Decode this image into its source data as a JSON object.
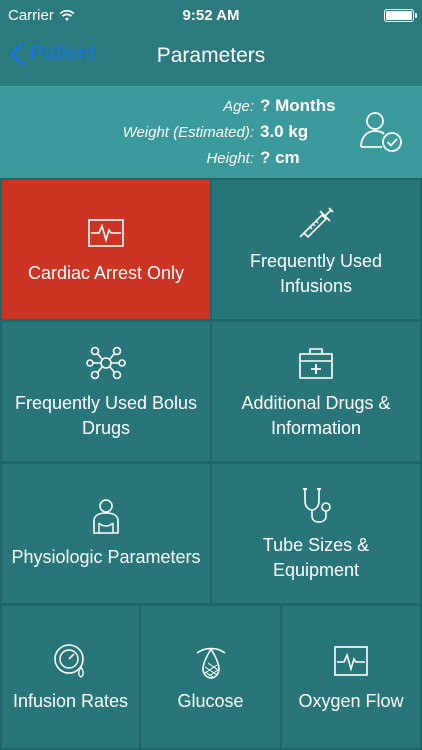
{
  "status": {
    "carrier": "Carrier",
    "time": "9:52 AM"
  },
  "nav": {
    "back_label": "Patient",
    "title": "Parameters"
  },
  "patient": {
    "age_label": "Age:",
    "age_value": "? Months",
    "weight_label": "Weight (Estimated):",
    "weight_value": "3.0 kg",
    "height_label": "Height:",
    "height_value": "? cm"
  },
  "tiles": [
    {
      "label": "Cardiac Arrest Only",
      "icon": "heart-monitor-icon",
      "color": "#cc3424"
    },
    {
      "label": "Frequently Used Infusions",
      "icon": "syringe-icon"
    },
    {
      "label": "Frequently Used Bolus Drugs",
      "icon": "molecule-icon"
    },
    {
      "label": "Additional Drugs & Information",
      "icon": "medical-kit-icon"
    },
    {
      "label": "Physiologic Parameters",
      "icon": "patient-icon"
    },
    {
      "label": "Tube Sizes & Equipment",
      "icon": "stethoscope-icon"
    },
    {
      "label": "Infusion Rates",
      "icon": "infusion-gauge-icon"
    },
    {
      "label": "Glucose",
      "icon": "glucose-icon"
    },
    {
      "label": "Oxygen Flow",
      "icon": "oxygen-monitor-icon"
    }
  ],
  "colors": {
    "nav": "#2b7a7e",
    "info": "#3a9a9c",
    "tile": "#287679",
    "grid": "#1f6669",
    "alert": "#cc3424",
    "link": "#1877e6"
  }
}
